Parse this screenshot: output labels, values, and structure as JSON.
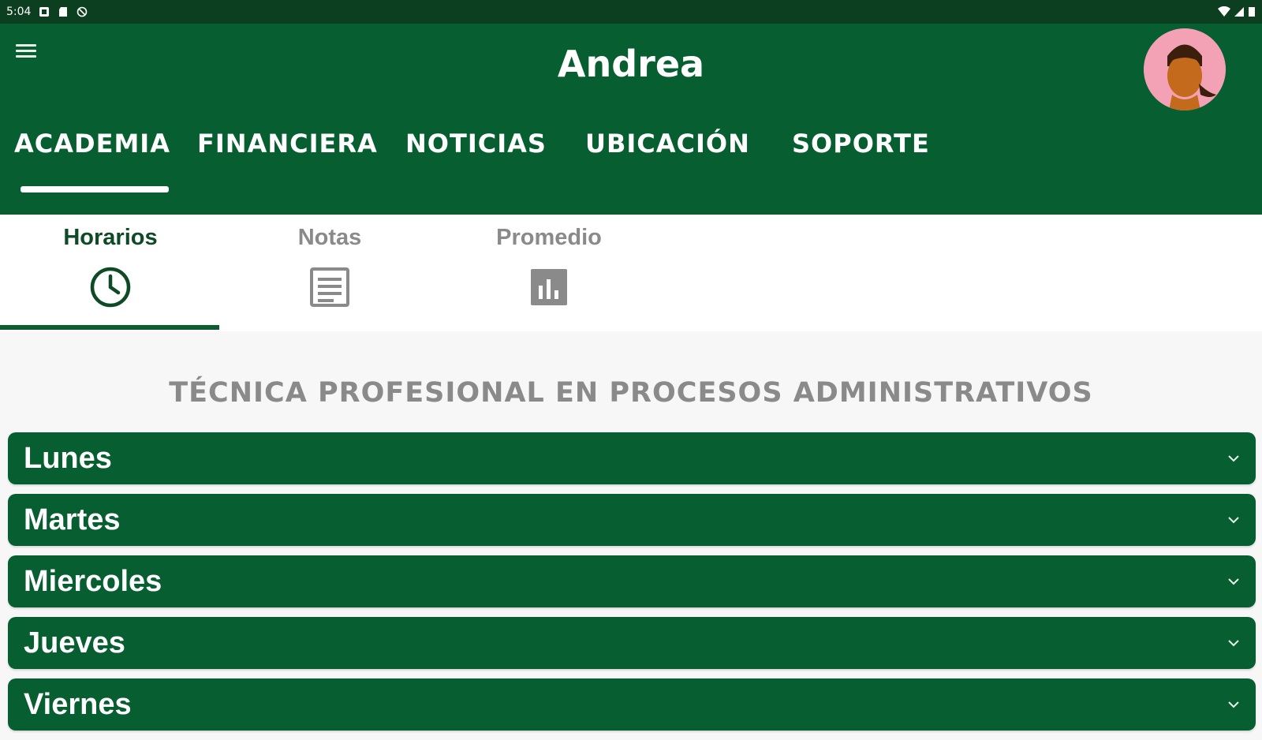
{
  "status_bar": {
    "time": "5:04",
    "icons": [
      "notification-icon",
      "sd-card-icon",
      "blocked-icon"
    ],
    "right_icons": [
      "wifi-icon",
      "signal-icon",
      "battery-icon"
    ]
  },
  "header": {
    "title": "Andrea",
    "menu_icon": "hamburger-menu-icon",
    "avatar_icon": "user-avatar-icon"
  },
  "main_tabs": [
    {
      "label": "ACADEMIA",
      "active": true
    },
    {
      "label": "FINANCIERA",
      "active": false
    },
    {
      "label": "NOTICIAS",
      "active": false
    },
    {
      "label": "UBICACIÓN",
      "active": false
    },
    {
      "label": "SOPORTE",
      "active": false
    }
  ],
  "sub_tabs": [
    {
      "label": "Horarios",
      "icon": "clock-icon",
      "active": true
    },
    {
      "label": "Notas",
      "icon": "document-icon",
      "active": false
    },
    {
      "label": "Promedio",
      "icon": "bar-chart-icon",
      "active": false
    }
  ],
  "program_title": "TÉCNICA PROFESIONAL EN PROCESOS ADMINISTRATIVOS",
  "days": [
    {
      "label": "Lunes"
    },
    {
      "label": "Martes"
    },
    {
      "label": "Miercoles"
    },
    {
      "label": "Jueves"
    },
    {
      "label": "Viernes"
    }
  ],
  "colors": {
    "primary": "#075e31",
    "status_bar": "#0b3f1f",
    "active_sub_tab": "#0f4a26",
    "inactive_text": "#8a8a8a",
    "avatar_bg": "#f2a2b4"
  }
}
